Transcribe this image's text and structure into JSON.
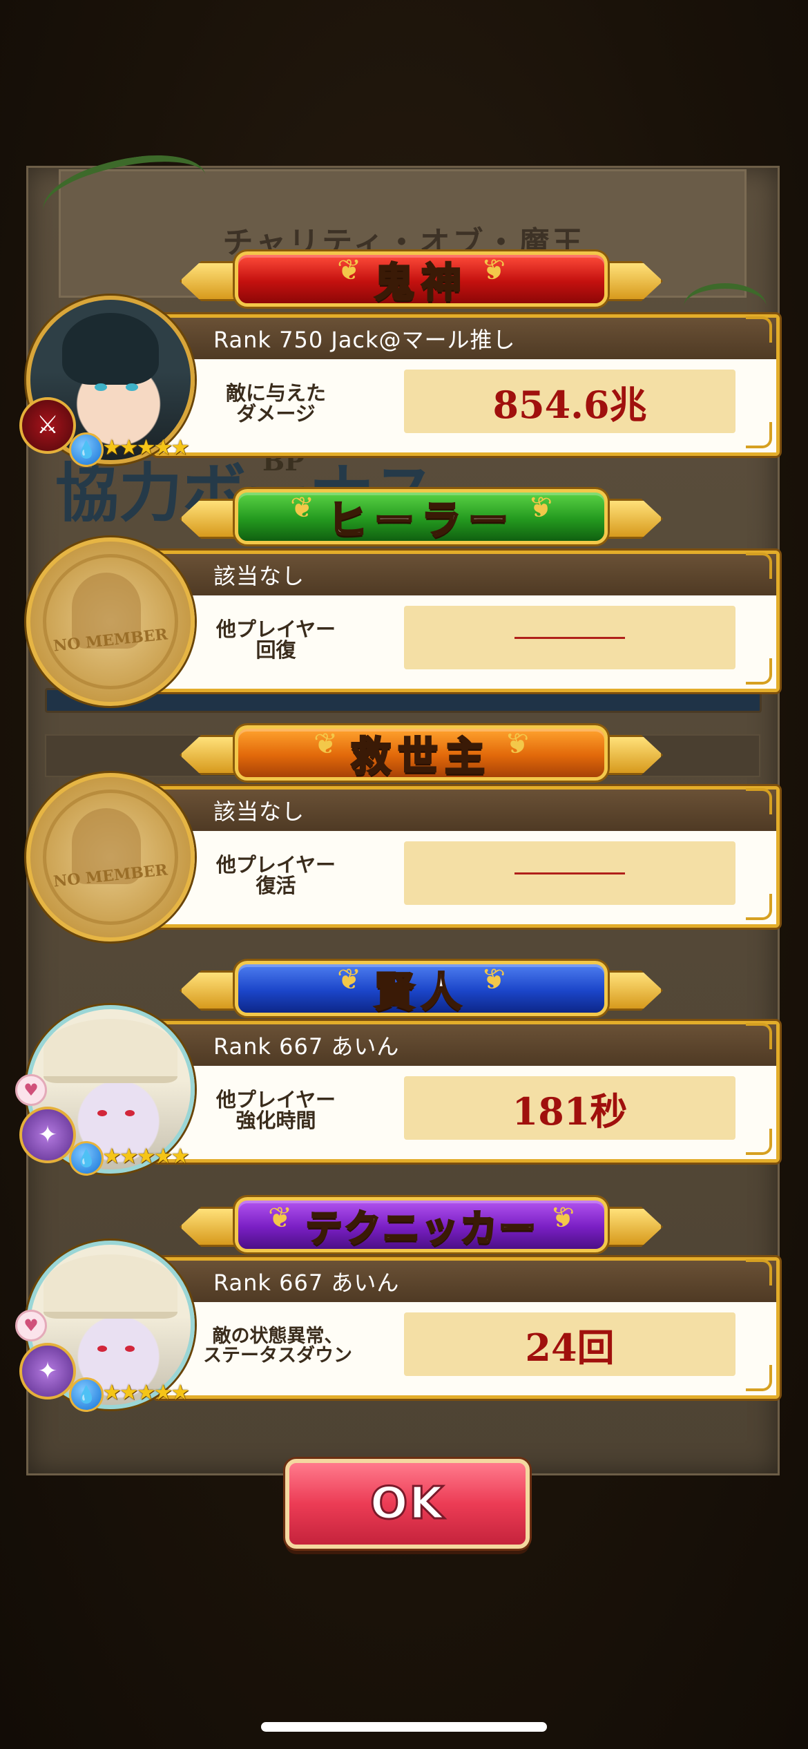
{
  "background_title": "チャリティ・オブ・魔王",
  "background_banner": "協力ボーナス",
  "background_bp": "BP",
  "awards": [
    {
      "title": "鬼神",
      "banner_color": "red",
      "player_line": "Rank  750   Jack@マール推し",
      "label_line1": "敵に与えた",
      "label_line2": "ダメージ",
      "value": "854.6兆",
      "avatar": "character-portrait-dark-hair",
      "class_icon": "sword-icon",
      "element_icon": "water-element-icon",
      "stars": "★★★★★"
    },
    {
      "title": "ヒーラー",
      "banner_color": "green",
      "player_line": "該当なし",
      "label_line1": "他プレイヤー",
      "label_line2": "回復",
      "value": "",
      "avatar": "no-member-emblem",
      "avatar_text": "NO MEMBER"
    },
    {
      "title": "救世主",
      "banner_color": "orange",
      "player_line": "該当なし",
      "label_line1": "他プレイヤー",
      "label_line2": "復活",
      "value": "",
      "avatar": "no-member-emblem",
      "avatar_text": "NO MEMBER"
    },
    {
      "title": "賢人",
      "banner_color": "blue",
      "player_line": "Rank  667   あいん",
      "label_line1": "他プレイヤー",
      "label_line2": "強化時間",
      "value": "181秒",
      "avatar": "character-portrait-white-hat",
      "class_icon": "magic-icon",
      "element_icon": "water-element-icon",
      "stars": "★★★★★"
    },
    {
      "title": "テクニッカー",
      "banner_color": "purple",
      "player_line": "Rank  667   あいん",
      "label_line1": "敵の状態異常、",
      "label_line2": "ステータスダウン",
      "value": "24回",
      "avatar": "character-portrait-white-hat",
      "class_icon": "magic-icon",
      "element_icon": "water-element-icon",
      "stars": "★★★★★"
    }
  ],
  "ok_label": "OK",
  "colors": {
    "red": "#c4110f",
    "green": "#249a1f",
    "orange": "#e2690a",
    "blue": "#1b45c9",
    "purple": "#7a1fc4",
    "value_text": "#a0100d",
    "ok_button": "#ec3c55"
  }
}
